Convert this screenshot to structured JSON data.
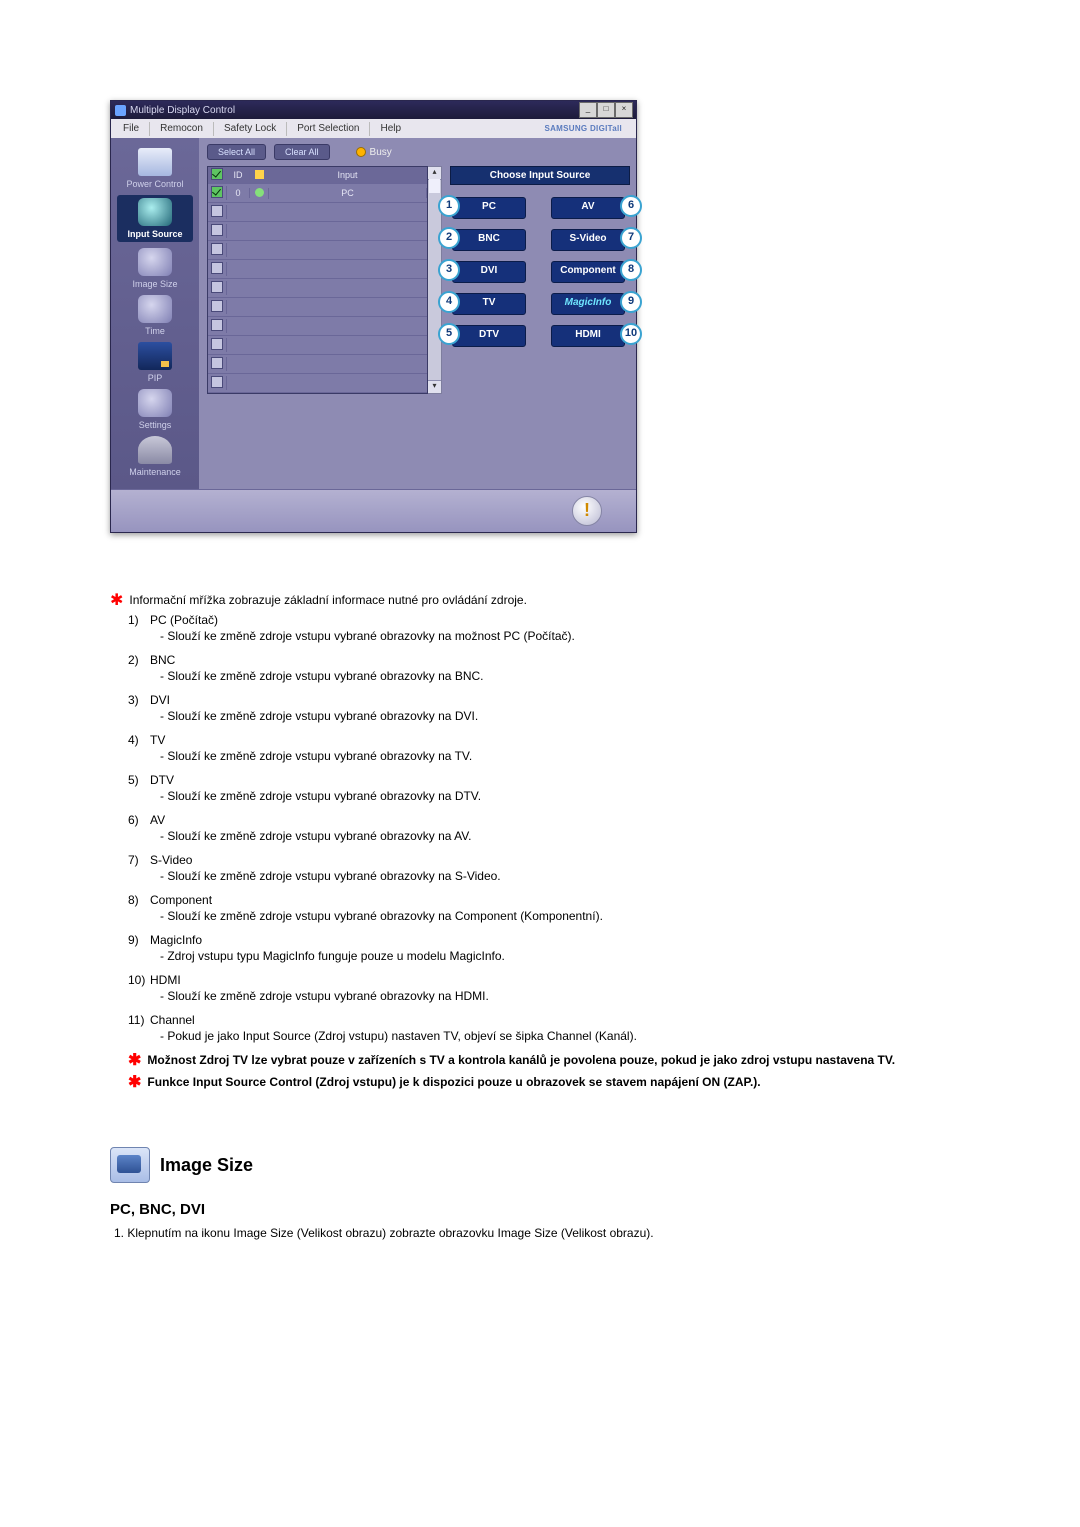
{
  "window": {
    "title": "Multiple Display Control",
    "win_min": "_",
    "win_max": "□",
    "win_close": "×"
  },
  "menubar": {
    "file": "File",
    "remocon": "Remocon",
    "safety_lock": "Safety Lock",
    "port_selection": "Port Selection",
    "help": "Help",
    "brand": "SAMSUNG DIGITall"
  },
  "sidebar": {
    "power": "Power Control",
    "input": "Input Source",
    "image": "Image Size",
    "time": "Time",
    "pip": "PIP",
    "settings": "Settings",
    "maintenance": "Maintenance"
  },
  "toolbar": {
    "select_all": "Select All",
    "clear_all": "Clear All",
    "busy": "Busy"
  },
  "grid": {
    "h_check": "✓",
    "h_id": "ID",
    "h_status": "",
    "h_input": "Input",
    "row_id": "0",
    "row_input": "PC"
  },
  "panel": {
    "title": "Choose Input Source",
    "buttons": [
      {
        "num": "1",
        "label": "PC",
        "side": "left"
      },
      {
        "num": "6",
        "label": "AV",
        "side": "right"
      },
      {
        "num": "2",
        "label": "BNC",
        "side": "left"
      },
      {
        "num": "7",
        "label": "S-Video",
        "side": "right"
      },
      {
        "num": "3",
        "label": "DVI",
        "side": "left"
      },
      {
        "num": "8",
        "label": "Component",
        "side": "right"
      },
      {
        "num": "4",
        "label": "TV",
        "side": "left"
      },
      {
        "num": "9",
        "label": "MagicInfo",
        "side": "right",
        "magic": true
      },
      {
        "num": "5",
        "label": "DTV",
        "side": "left"
      },
      {
        "num": "10",
        "label": "HDMI",
        "side": "right"
      }
    ]
  },
  "doc": {
    "intro": "Informační mřížka zobrazuje základní informace nutné pro ovládání zdroje.",
    "items": [
      {
        "n": "1)",
        "t": "PC (Počítač)",
        "d": "- Slouží ke změně zdroje vstupu vybrané obrazovky na možnost PC (Počítač)."
      },
      {
        "n": "2)",
        "t": "BNC",
        "d": "- Slouží ke změně zdroje vstupu vybrané obrazovky na BNC."
      },
      {
        "n": "3)",
        "t": "DVI",
        "d": "- Slouží ke změně zdroje vstupu vybrané obrazovky na DVI."
      },
      {
        "n": "4)",
        "t": "TV",
        "d": "- Slouží ke změně zdroje vstupu vybrané obrazovky na TV."
      },
      {
        "n": "5)",
        "t": "DTV",
        "d": "- Slouží ke změně zdroje vstupu vybrané obrazovky na DTV."
      },
      {
        "n": "6)",
        "t": "AV",
        "d": "- Slouží ke změně zdroje vstupu vybrané obrazovky na AV."
      },
      {
        "n": "7)",
        "t": "S-Video",
        "d": "- Slouží ke změně zdroje vstupu vybrané obrazovky na S-Video."
      },
      {
        "n": "8)",
        "t": "Component",
        "d": "- Slouží ke změně zdroje vstupu vybrané obrazovky na Component (Komponentní)."
      },
      {
        "n": "9)",
        "t": "MagicInfo",
        "d": "- Zdroj vstupu typu MagicInfo funguje pouze u modelu MagicInfo."
      },
      {
        "n": "10)",
        "t": "HDMI",
        "d": "- Slouží ke změně zdroje vstupu vybrané obrazovky na HDMI."
      },
      {
        "n": "11)",
        "t": "Channel",
        "d": "- Pokud je jako Input Source (Zdroj vstupu) nastaven TV, objeví se šipka Channel (Kanál)."
      }
    ],
    "note1": "Možnost Zdroj TV lze vybrat pouze v zařízeních s TV a kontrola kanálů je povolena pouze, pokud je jako zdroj vstupu nastavena TV.",
    "note2": "Funkce Input Source Control (Zdroj vstupu) je k dispozici pouze u obrazovek se stavem napájení ON (ZAP.)."
  },
  "section": {
    "title": "Image Size",
    "subhead": "PC, BNC, DVI",
    "step1": "1. Klepnutím na ikonu Image Size (Velikost obrazu) zobrazte obrazovku Image Size (Velikost obrazu)."
  },
  "scroll": {
    "up": "▴",
    "down": "▾"
  },
  "warn_glyph": "!"
}
